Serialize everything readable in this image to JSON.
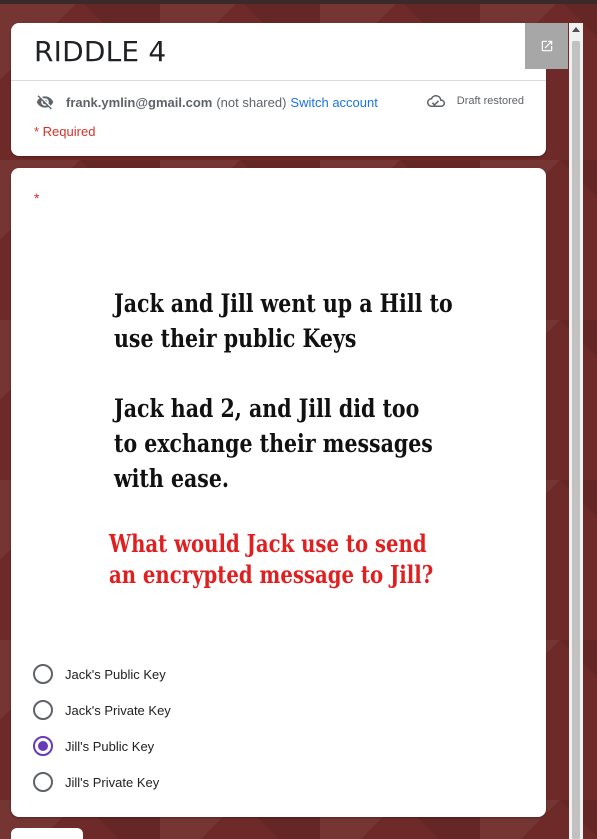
{
  "header": {
    "title": "RIDDLE 4",
    "account_email": "frank.ymlin@gmail.com",
    "not_shared_text": "(not shared)",
    "switch_account_label": "Switch account",
    "draft_status": "Draft restored",
    "required_note": "* Required"
  },
  "question": {
    "required_marker": "*",
    "riddle_lines": [
      "Jack and Jill went up a Hill to",
      "use their public Keys",
      "Jack had 2, and Jill did too",
      "to exchange their messages",
      "with ease."
    ],
    "question_lines": [
      "What would Jack use to send",
      "an encrypted message to Jill?"
    ],
    "options": [
      {
        "label": "Jack's Public Key",
        "selected": false
      },
      {
        "label": "Jack's Private Key",
        "selected": false
      },
      {
        "label": "Jill's Public Key",
        "selected": true
      },
      {
        "label": "Jill's Private Key",
        "selected": false
      }
    ]
  },
  "icons": {
    "visibility": "visibility-off-icon",
    "cloud": "cloud-done-icon",
    "open": "open-in-new-icon"
  },
  "colors": {
    "accent": "#673ab7",
    "link": "#1a73e8",
    "required": "#d93025",
    "question_text": "#e02020",
    "background": "#6e2a28"
  }
}
